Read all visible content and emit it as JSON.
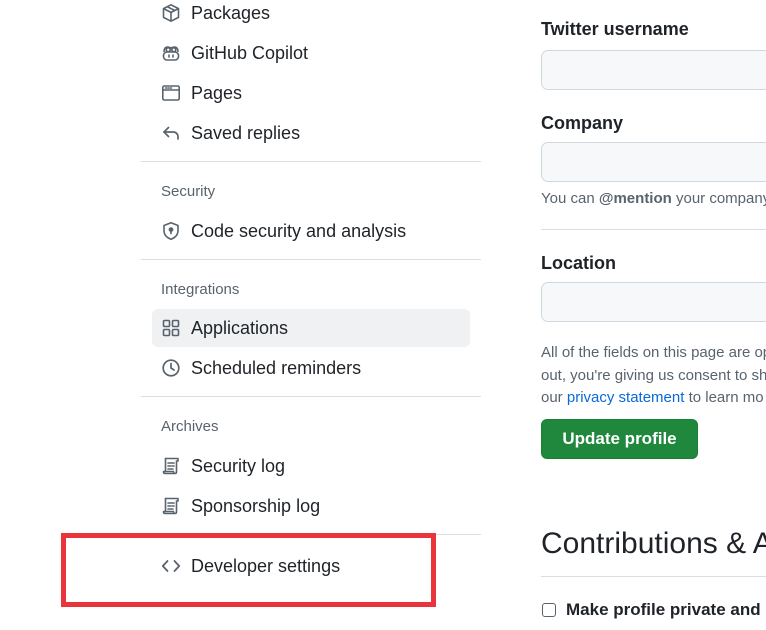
{
  "sidebar": {
    "items_top": [
      {
        "label": "Packages",
        "icon": "package-icon"
      },
      {
        "label": "GitHub Copilot",
        "icon": "copilot-icon"
      },
      {
        "label": "Pages",
        "icon": "browser-icon"
      },
      {
        "label": "Saved replies",
        "icon": "reply-icon"
      }
    ],
    "security": {
      "heading": "Security",
      "items": [
        {
          "label": "Code security and analysis",
          "icon": "shield-lock-icon"
        }
      ]
    },
    "integrations": {
      "heading": "Integrations",
      "items": [
        {
          "label": "Applications",
          "icon": "apps-icon",
          "active": true
        },
        {
          "label": "Scheduled reminders",
          "icon": "clock-icon"
        }
      ]
    },
    "archives": {
      "heading": "Archives",
      "items": [
        {
          "label": "Security log",
          "icon": "log-icon"
        },
        {
          "label": "Sponsorship log",
          "icon": "log-icon"
        }
      ]
    },
    "developer_settings": {
      "label": "Developer settings",
      "icon": "code-icon"
    }
  },
  "form": {
    "twitter": {
      "label": "Twitter username",
      "value": ""
    },
    "company": {
      "label": "Company",
      "value": "",
      "note_prefix": "You can ",
      "note_mention": "@mention",
      "note_suffix": " your company"
    },
    "location": {
      "label": "Location",
      "value": ""
    },
    "disclaimer": {
      "line1": "All of the fields on this page are op",
      "line2": "out, you're giving us consent to sh",
      "line3_prefix": "our ",
      "line3_link": "privacy statement",
      "line3_suffix": " to learn mo"
    },
    "update_button": "Update profile"
  },
  "contributions": {
    "title": "Contributions & A",
    "private_checkbox_label": "Make profile private and",
    "private_checked": false
  },
  "colors": {
    "primary_button": "#1f883d",
    "link": "#0969da",
    "highlight_box": "#e8343a",
    "active_item_bg": "#eff1f3"
  }
}
